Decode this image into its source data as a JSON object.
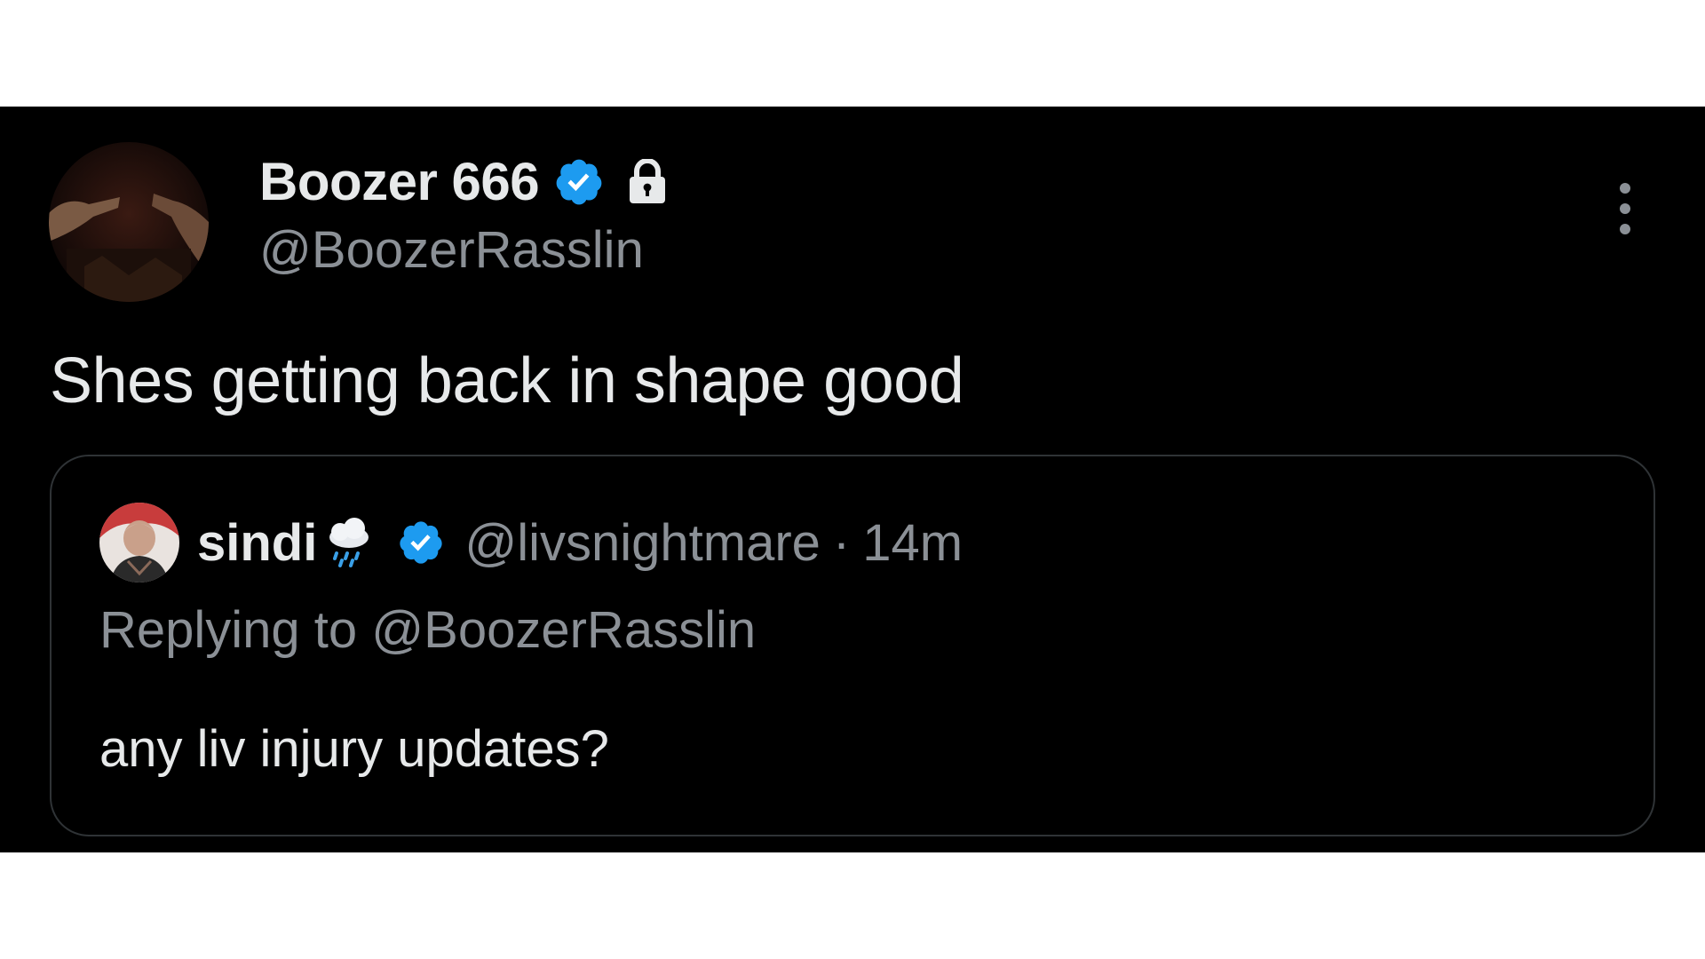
{
  "tweet": {
    "author": {
      "display_name": "Boozer 666",
      "handle": "@BoozerRasslin",
      "verified_icon": "verified-badge-icon",
      "locked_icon": "lock-icon",
      "avatar_icon": "avatar-image"
    },
    "more_icon": "more-options-icon",
    "text": "Shes getting back in shape good",
    "quote": {
      "author": {
        "display_name": "sindi",
        "name_emoji": "🌧️",
        "handle": "@livsnightmare",
        "separator": "·",
        "time": "14m",
        "verified_icon": "verified-badge-icon",
        "avatar_icon": "avatar-image"
      },
      "reply_line": "Replying to @BoozerRasslin",
      "text": "any liv injury updates?"
    }
  },
  "colors": {
    "background": "#000000",
    "text_primary": "#e7e9ea",
    "text_secondary": "#8b9096",
    "verified_blue": "#1d9bf0",
    "border": "#2f3336"
  }
}
